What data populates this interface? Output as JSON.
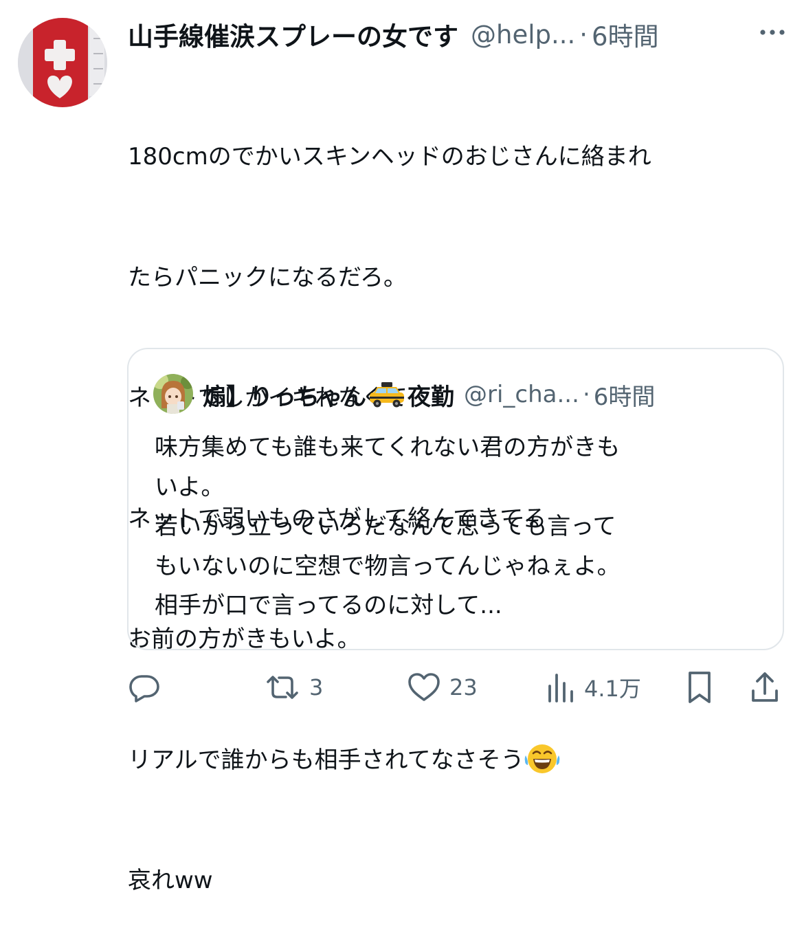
{
  "post": {
    "display_name": "山手線催涙スプレーの女です",
    "handle": "@help...",
    "separator": "·",
    "time": "6時間",
    "text_lines": [
      "180cmのでかいスキンヘッドのおじさんに絡まれ",
      "たらパニックになるだろ。",
      "ネットでしかイキれなくて",
      "ネットで弱いものさがして絡んできてる",
      "お前の方がきもいよ。",
      "リアルで誰からも相手されてなさそう",
      "哀れww"
    ],
    "emoji": "joy-emoji"
  },
  "quoted": {
    "display_name_prefix": "煽】りっちゃん",
    "display_name_suffix": "夜勤",
    "name_emoji": "taxi-emoji",
    "handle": "@ri_cha...",
    "separator": "·",
    "time": "6時間",
    "text_lines": [
      "味方集めても誰も来てくれない君の方がきも",
      "いよ。",
      "若いから立っていろだなんて思っても言って",
      "もいないのに空想で物言ってんじゃねぇよ。",
      "相手が口で言ってるのに対して..."
    ]
  },
  "actions": {
    "reply": {
      "icon": "reply-icon",
      "count": ""
    },
    "repost": {
      "icon": "repost-icon",
      "count": "3"
    },
    "like": {
      "icon": "heart-icon",
      "count": "23"
    },
    "views": {
      "icon": "views-icon",
      "count": "4.1万"
    },
    "bookmark": {
      "icon": "bookmark-icon"
    },
    "share": {
      "icon": "share-icon"
    }
  },
  "colors": {
    "text": "#0f1419",
    "secondary": "#536471",
    "border": "#e1e6ea",
    "avatar_red": "#c8232c"
  }
}
